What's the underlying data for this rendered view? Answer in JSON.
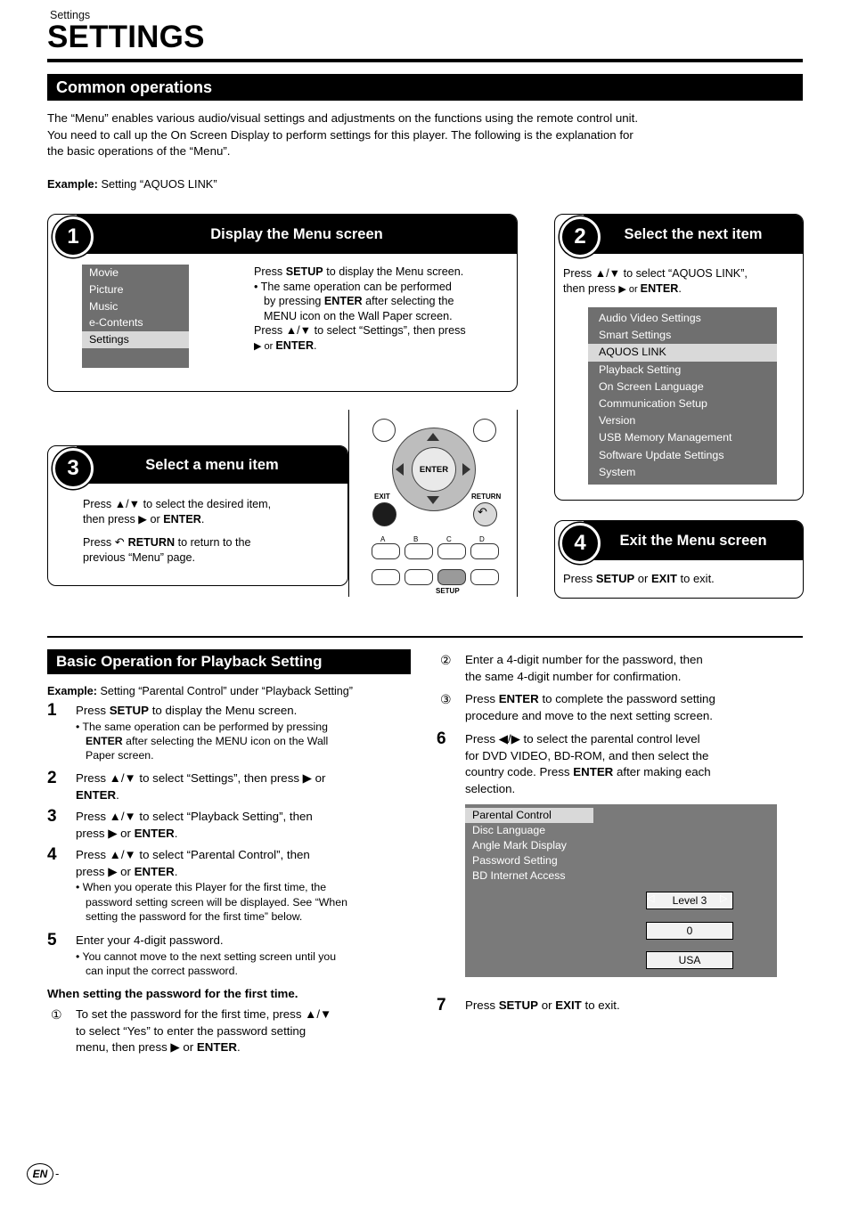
{
  "header": {
    "eyebrow": "Settings",
    "title": "SETTINGS"
  },
  "common": {
    "bar_label": "Common operations",
    "paragraph_line1": "The “Menu” enables various audio/visual settings and adjustments on the functions using the remote control unit.",
    "paragraph_line2": "You need to call up the On Screen Display to perform settings for this player. The following is the explanation for",
    "paragraph_line3": "the basic operations of the “Menu”.",
    "example_label": "Example:",
    "example_text": " Setting “AQUOS LINK”"
  },
  "steps": {
    "s1": {
      "number": "1",
      "title": "Display the Menu screen",
      "menu": [
        "Movie",
        "Picture",
        "Music",
        "e-Contents",
        "Settings"
      ],
      "menu_selected": "Settings",
      "line1_a": "Press ",
      "line1_b": "SETUP",
      "line1_c": " to display the Menu screen.",
      "bullet_a": "•  The same operation can be performed",
      "bullet_b": "by pressing ",
      "bullet_b2": "ENTER",
      "bullet_b3": " after selecting the",
      "bullet_c": "MENU icon on the Wall Paper screen.",
      "line2_a": "Press ▲/▼ to select “Settings”, then press",
      "line2_b": "▶ or ",
      "line2_b2": "ENTER",
      "line2_b3": "."
    },
    "s2": {
      "number": "2",
      "title": "Select the next item",
      "line1": "Press ▲/▼ to select “AQUOS LINK”,",
      "line2_a": "then press ",
      "line2_b": "▶ or ",
      "line2_c": "ENTER",
      "line2_d": ".",
      "menu": [
        "Audio Video Settings",
        "Smart Settings",
        "AQUOS LINK",
        "Playback Setting",
        "On Screen Language",
        "Communication Setup",
        "Version",
        "USB Memory Management",
        "Software Update Settings",
        "System"
      ],
      "menu_selected": "AQUOS LINK"
    },
    "s3": {
      "number": "3",
      "title": "Select a menu item",
      "line1": "Press ▲/▼ to select the desired item,",
      "line2_a": "then press ▶ or ",
      "line2_b": "ENTER",
      "line2_c": ".",
      "line3_a": "Press ",
      "line3_b": "RETURN",
      "line3_c": " to return to the",
      "line4": "previous “Menu” page."
    },
    "s4": {
      "number": "4",
      "title": "Exit the Menu screen",
      "line_a": "Press ",
      "line_b": "SETUP",
      "line_c": " or ",
      "line_d": "EXIT",
      "line_e": " to exit."
    }
  },
  "remote": {
    "enter_label": "ENTER",
    "exit_label": "EXIT",
    "return_label": "RETURN",
    "setup_label": "SETUP",
    "color_a": "A",
    "color_b": "B",
    "color_c": "C",
    "color_d": "D"
  },
  "playback": {
    "bar_label": "Basic Operation for Playback Setting",
    "example_label": "Example:",
    "example_text": " Setting “Parental Control” under “Playback Setting”",
    "items": [
      {
        "num": "1",
        "text_a": "Press ",
        "text_b": "SETUP",
        "text_c": " to display the Menu screen.",
        "sub1": "•  The same operation can be performed by pressing",
        "sub2_b": "ENTER",
        "sub2_c": " after selecting the MENU icon on the Wall",
        "sub3": "Paper screen."
      },
      {
        "num": "2",
        "line1": "Press ▲/▼ to select “Settings”, then press ▶ or",
        "line2_b": "ENTER",
        "line2_c": "."
      },
      {
        "num": "3",
        "line1": "Press ▲/▼ to select “Playback Setting”, then",
        "line2_a": "press ▶ or ",
        "line2_b": "ENTER",
        "line2_c": "."
      },
      {
        "num": "4",
        "line1": "Press ▲/▼ to select “Parental Control”, then",
        "line2_a": "press ▶ or ",
        "line2_b": "ENTER",
        "line2_c": ".",
        "sub1": "•  When you operate this Player for the first time, the",
        "sub2": "password setting screen will be displayed. See “When",
        "sub3": "setting the password for the first time” below."
      },
      {
        "num": "5",
        "line1": "Enter your 4-digit password.",
        "sub1": "•  You cannot move to the next setting screen until you",
        "sub2": "can input the correct password."
      }
    ],
    "first_time_heading": "When setting the password for the first time.",
    "first_time_1_a": "To set the password for the first time, press ▲/▼",
    "first_time_1_b": "to select “Yes” to enter the password setting",
    "first_time_1_c_a": "menu, then press ▶ or ",
    "first_time_1_c_b": "ENTER",
    "first_time_1_c_c": "."
  },
  "right_column": {
    "c2_line1": "Enter a 4-digit number for the password, then",
    "c2_line2": "the same 4-digit number for confirmation.",
    "c3_line1_a": "Press ",
    "c3_line1_b": "ENTER",
    "c3_line1_c": " to complete the password setting",
    "c3_line2": "procedure and move to the next setting screen.",
    "item6": {
      "num": "6",
      "line1": "Press ◀/▶ to select the parental control level",
      "line2": "for DVD VIDEO, BD-ROM, and then select the",
      "line3_a": "country code. Press ",
      "line3_b": "ENTER",
      "line3_c": " after making each",
      "line4": "selection."
    },
    "item7": {
      "num": "7",
      "line_a": "Press ",
      "line_b": "SETUP",
      "line_c": " or ",
      "line_d": "EXIT",
      "line_e": " to exit."
    },
    "osd": {
      "rows": [
        "Parental Control",
        "Disc Language",
        "Angle Mark Display",
        "Password Setting",
        "BD Internet Access"
      ],
      "selected": "Parental Control",
      "value_level": "Level 3",
      "value_rating": "0",
      "value_country": "USA"
    }
  },
  "footer": {
    "lang_badge": "EN",
    "dash": "-"
  }
}
